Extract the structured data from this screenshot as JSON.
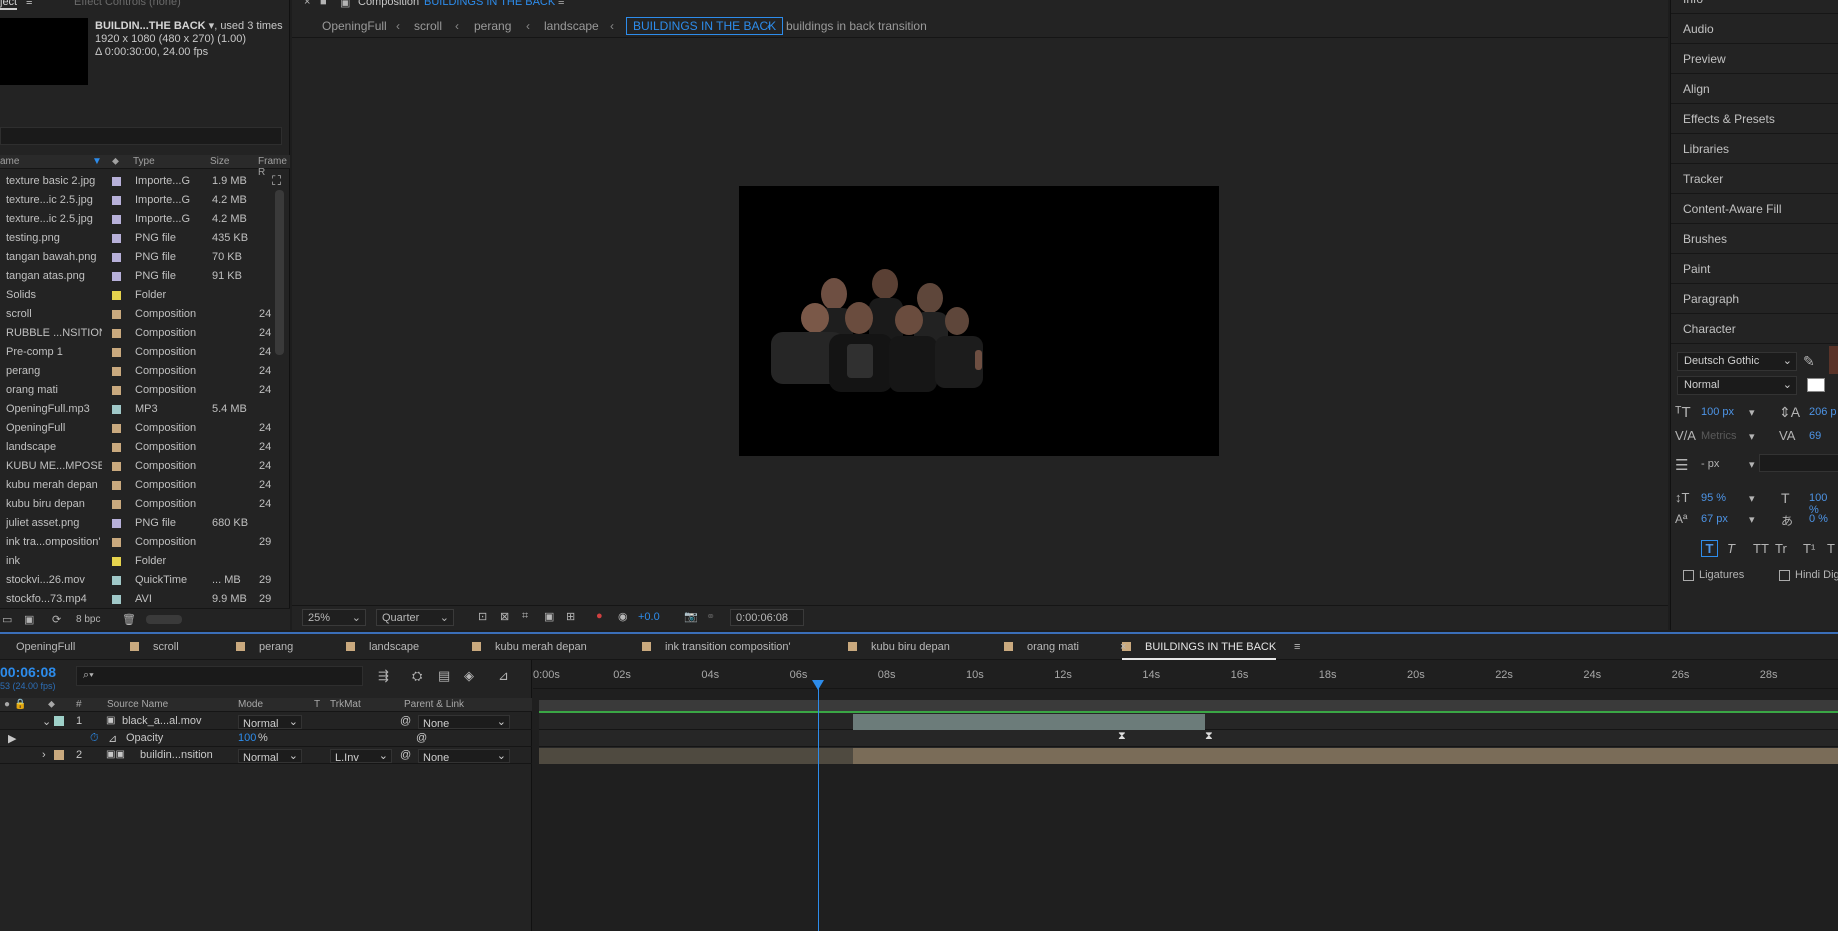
{
  "project": {
    "top_tabs": [
      "ject",
      "Effect Controls (none)"
    ],
    "thumb_title": "BUILDIN...THE BACK",
    "thumb_used": ", used 3 times",
    "thumb_dims": "1920 x 1080  (480 x 270) (1.00)",
    "thumb_duration": "Δ 0:00:30:00, 24.00 fps",
    "columns": [
      "ame",
      "Type",
      "Size",
      "Frame R"
    ],
    "items": [
      {
        "name": "texture basic 2.jpg",
        "color": "#b7b0d9",
        "type": "Importe...G",
        "size": "1.9 MB",
        "frame": ""
      },
      {
        "name": "texture...ic 2.5.jpg",
        "color": "#b7b0d9",
        "type": "Importe...G",
        "size": "4.2 MB",
        "frame": ""
      },
      {
        "name": "texture...ic 2.5.jpg",
        "color": "#b7b0d9",
        "type": "Importe...G",
        "size": "4.2 MB",
        "frame": ""
      },
      {
        "name": "testing.png",
        "color": "#b7b0d9",
        "type": "PNG file",
        "size": "435 KB",
        "frame": ""
      },
      {
        "name": "tangan bawah.png",
        "color": "#b7b0d9",
        "type": "PNG file",
        "size": "70 KB",
        "frame": ""
      },
      {
        "name": "tangan atas.png",
        "color": "#b7b0d9",
        "type": "PNG file",
        "size": "91 KB",
        "frame": ""
      },
      {
        "name": "Solids",
        "color": "#e6d34d",
        "type": "Folder",
        "size": "",
        "frame": ""
      },
      {
        "name": "scroll",
        "color": "#c9a97e",
        "type": "Composition",
        "size": "",
        "frame": "24"
      },
      {
        "name": "RUBBLE ...NSITION",
        "color": "#c9a97e",
        "type": "Composition",
        "size": "",
        "frame": "24"
      },
      {
        "name": "Pre-comp 1",
        "color": "#c9a97e",
        "type": "Composition",
        "size": "",
        "frame": "24"
      },
      {
        "name": "perang",
        "color": "#c9a97e",
        "type": "Composition",
        "size": "",
        "frame": "24"
      },
      {
        "name": "orang mati",
        "color": "#c9a97e",
        "type": "Composition",
        "size": "",
        "frame": "24"
      },
      {
        "name": "OpeningFull.mp3",
        "color": "#a0c8c8",
        "type": "MP3",
        "size": "5.4 MB",
        "frame": ""
      },
      {
        "name": "OpeningFull",
        "color": "#c9a97e",
        "type": "Composition",
        "size": "",
        "frame": "24"
      },
      {
        "name": "landscape",
        "color": "#c9a97e",
        "type": "Composition",
        "size": "",
        "frame": "24"
      },
      {
        "name": "KUBU ME...MPOSE",
        "color": "#c9a97e",
        "type": "Composition",
        "size": "",
        "frame": "24"
      },
      {
        "name": "kubu merah depan",
        "color": "#c9a97e",
        "type": "Composition",
        "size": "",
        "frame": "24"
      },
      {
        "name": "kubu biru depan",
        "color": "#c9a97e",
        "type": "Composition",
        "size": "",
        "frame": "24"
      },
      {
        "name": "juliet asset.png",
        "color": "#b7b0d9",
        "type": "PNG file",
        "size": "680 KB",
        "frame": ""
      },
      {
        "name": "ink tra...omposition'",
        "color": "#c9a97e",
        "type": "Composition",
        "size": "",
        "frame": "29"
      },
      {
        "name": "ink",
        "color": "#e6d34d",
        "type": "Folder",
        "size": "",
        "frame": ""
      },
      {
        "name": "stockvi...26.mov",
        "color": "#a0c8c8",
        "type": "QuickTime",
        "size": "... MB",
        "frame": "29"
      },
      {
        "name": "stockfo...73.mp4",
        "color": "#a0c8c8",
        "type": "AVI",
        "size": "9.9 MB",
        "frame": "29"
      }
    ],
    "bpc": "8 bpc"
  },
  "composition": {
    "tab_label": "Composition",
    "tab_name": "BUILDINGS IN THE BACK",
    "breadcrumb": [
      "OpeningFull",
      "scroll",
      "perang",
      "landscape",
      "BUILDINGS IN THE BACK",
      "buildings in back transition"
    ],
    "zoom": "25%",
    "resolution": "Quarter",
    "exposure": "+0.0",
    "timecode": "0:00:06:08"
  },
  "right_panel": {
    "items": [
      "Info",
      "Audio",
      "Preview",
      "Align",
      "Effects & Presets",
      "Libraries",
      "Tracker",
      "Content-Aware Fill",
      "Brushes",
      "Paint",
      "Paragraph",
      "Character"
    ],
    "font": "Deutsch Gothic",
    "style": "Normal",
    "font_size": "100 px",
    "leading": "206 p",
    "kerning": "Metrics",
    "tracking": "69",
    "stroke": "- px",
    "vscale": "95 %",
    "hscale": "100 %",
    "baseline": "67 px",
    "tsume": "0 %",
    "style_buttons": [
      "T",
      "T",
      "TT",
      "Tr",
      "T¹",
      "T"
    ],
    "ligatures": "Ligatures",
    "hindi": "Hindi Dig",
    "fill_color": "#5a3328"
  },
  "timeline": {
    "tabs": [
      {
        "label": "OpeningFull",
        "color": "#c9a97e"
      },
      {
        "label": "scroll",
        "color": "#c9a97e"
      },
      {
        "label": "perang",
        "color": "#c9a97e"
      },
      {
        "label": "landscape",
        "color": "#c9a97e"
      },
      {
        "label": "kubu merah depan",
        "color": "#c9a97e"
      },
      {
        "label": "ink transition composition'",
        "color": "#c9a97e"
      },
      {
        "label": "kubu biru depan",
        "color": "#c9a97e"
      },
      {
        "label": "orang mati",
        "color": "#c9a97e"
      },
      {
        "label": "BUILDINGS IN THE BACK",
        "color": "#c9a97e"
      }
    ],
    "timecode": "00:06:08",
    "fps": "53 (24.00 fps)",
    "columns": [
      "#",
      "Source Name",
      "Mode",
      "T",
      "TrkMat",
      "Parent & Link"
    ],
    "layers": [
      {
        "num": "1",
        "name": "black_a...al.mov",
        "mode": "Normal",
        "trkmat": "",
        "parent": "None"
      },
      {
        "num": "",
        "name": "Opacity",
        "value": "100",
        "unit": "%"
      },
      {
        "num": "2",
        "name": "buildin...nsition",
        "mode": "Normal",
        "trkmat": "L.Inv",
        "parent": "None"
      }
    ],
    "ruler": [
      "0:00s",
      "02s",
      "04s",
      "06s",
      "08s",
      "10s",
      "12s",
      "14s",
      "16s",
      "18s",
      "20s",
      "22s",
      "24s",
      "26s",
      "28s"
    ]
  }
}
